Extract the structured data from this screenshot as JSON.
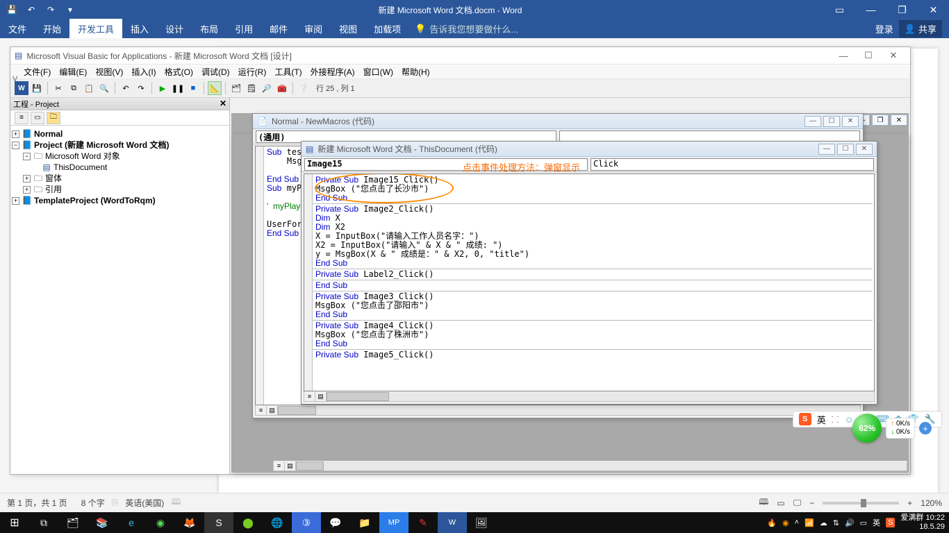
{
  "word": {
    "title": "新建 Microsoft Word 文档.docm - Word",
    "tabs": [
      "文件",
      "开始",
      "开发工具",
      "插入",
      "设计",
      "布局",
      "引用",
      "邮件",
      "审阅",
      "视图",
      "加载项"
    ],
    "active_tab": "开发工具",
    "tellme_placeholder": "告诉我您想要做什么...",
    "login": "登录",
    "share": "共享"
  },
  "vba": {
    "title": "Microsoft Visual Basic for Applications - 新建 Microsoft Word 文档 [设计]",
    "menus": [
      "文件(F)",
      "编辑(E)",
      "视图(V)",
      "插入(I)",
      "格式(O)",
      "调试(D)",
      "运行(R)",
      "工具(T)",
      "外接程序(A)",
      "窗口(W)",
      "帮助(H)"
    ],
    "cursor_status": "行 25 , 列 1",
    "project_panel_title": "工程 - Project",
    "tree": {
      "normal": "Normal",
      "project": "Project (新建 Microsoft Word 文档)",
      "word_objects": "Microsoft Word 对象",
      "thisdoc": "ThisDocument",
      "forms": "窗体",
      "refs": "引用",
      "template": "TemplateProject (WordToRqm)"
    }
  },
  "codewin1": {
    "title": "Normal - NewMacros (代码)",
    "left_selector": "(通用)",
    "right_selector": "",
    "code_lines": [
      "Sub testo",
      "    MsgBo",
      "",
      "End Sub",
      "Sub myPla",
      "",
      "'  myPlaye",
      "",
      "UserForm1",
      "End Sub"
    ]
  },
  "codewin2": {
    "title": "新建 Microsoft Word 文档 - ThisDocument (代码)",
    "left_selector": "Image15",
    "right_selector": "Click",
    "annotation": "点击事件处理方法：弹窗显示",
    "code": "Private Sub Image15_Click()\nMsgBox (\"您点击了长沙市\")\nEnd Sub\n\nPrivate Sub Image2_Click()\nDim X\nDim X2\nX = InputBox(\"请输入工作人员名字：\")\nX2 = InputBox(\"请输入\" & X & \" 成绩: \")\ny = MsgBox(X & \" 成绩是：\" & X2, 0, \"title\")\nEnd Sub\n\nPrivate Sub Label2_Click()\n\nEnd Sub\n\nPrivate Sub Image3_Click()\nMsgBox (\"您点击了邵阳市\")\nEnd Sub\n\nPrivate Sub Image4_Click()\nMsgBox (\"您点击了株洲市\")\nEnd Sub\n\nPrivate Sub Image5_Click()"
  },
  "statusbar": {
    "page": "第 1 页，共 1 页",
    "words": "8 个字",
    "lang": "英语(美国)",
    "zoom": "120%"
  },
  "sogou": {
    "lang": "英",
    "items": [
      "⸬",
      "☺",
      "🎤",
      "⌨",
      "✿",
      "👕",
      "🔧"
    ]
  },
  "netmon": {
    "pct": "62%",
    "up": "0K/s",
    "down": "0K/s"
  },
  "taskbar": {
    "user": "爱满群",
    "time": "10:22",
    "date": "18.5.29",
    "ime": "英"
  }
}
